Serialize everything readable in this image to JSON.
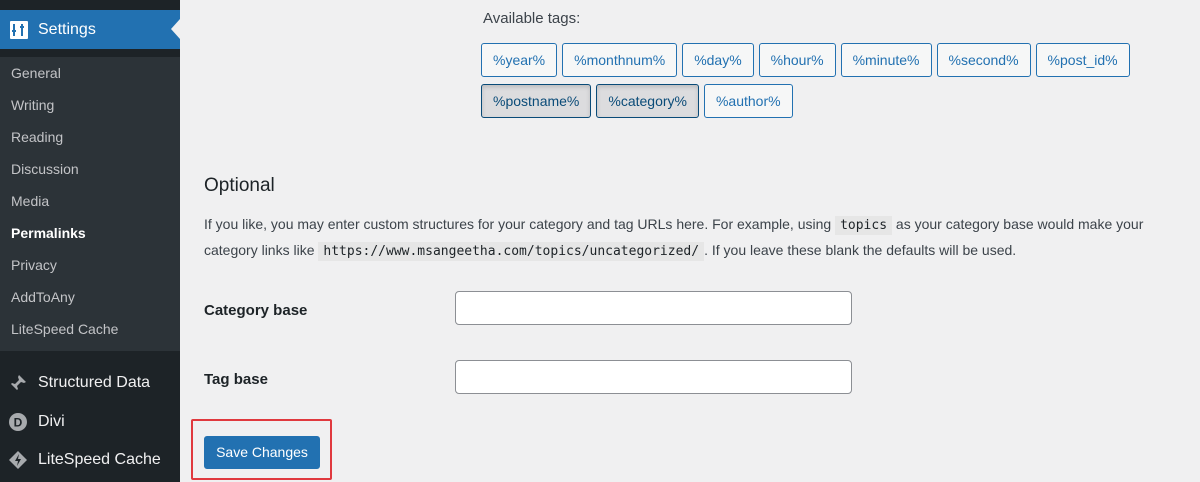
{
  "sidebar": {
    "header_label": "Settings",
    "submenu": [
      {
        "label": "General",
        "current": false
      },
      {
        "label": "Writing",
        "current": false
      },
      {
        "label": "Reading",
        "current": false
      },
      {
        "label": "Discussion",
        "current": false
      },
      {
        "label": "Media",
        "current": false
      },
      {
        "label": "Permalinks",
        "current": true
      },
      {
        "label": "Privacy",
        "current": false
      },
      {
        "label": "AddToAny",
        "current": false
      },
      {
        "label": "LiteSpeed Cache",
        "current": false
      }
    ],
    "lower_items": [
      {
        "label": "Structured Data",
        "icon": "pin-icon"
      },
      {
        "label": "Divi",
        "icon": "divi-icon"
      },
      {
        "label": "LiteSpeed Cache",
        "icon": "litespeed-icon"
      }
    ]
  },
  "tags": {
    "label": "Available tags:",
    "row1": [
      "%year%",
      "%monthnum%",
      "%day%",
      "%hour%",
      "%minute%",
      "%second%",
      "%post_id%"
    ],
    "row2": [
      "%postname%",
      "%category%",
      "%author%"
    ],
    "active": [
      "%postname%",
      "%category%"
    ]
  },
  "optional": {
    "title": "Optional",
    "desc_part1": "If you like, you may enter custom structures for your category and tag URLs here. For example, using",
    "desc_code1": "topics",
    "desc_part2": "as your category base would make your category links like",
    "desc_code2": "https://www.msangeetha.com/topics/uncategorized/",
    "desc_part3": ". If you leave these blank the defaults will be used."
  },
  "fields": {
    "category_base_label": "Category base",
    "category_base_value": "",
    "tag_base_label": "Tag base",
    "tag_base_value": ""
  },
  "save_label": "Save Changes",
  "colors": {
    "sidebar_bg": "#1d2327",
    "submenu_bg": "#2c3338",
    "accent": "#2271b1",
    "highlight": "#e0393e"
  }
}
